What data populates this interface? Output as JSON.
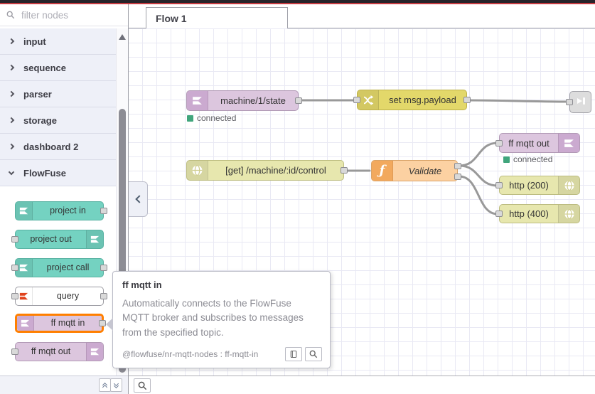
{
  "app": {
    "name": "Node-RED flow editor"
  },
  "palette": {
    "search": {
      "placeholder": "filter nodes"
    },
    "categories": [
      {
        "label": "input",
        "expanded": false
      },
      {
        "label": "sequence",
        "expanded": false
      },
      {
        "label": "parser",
        "expanded": false
      },
      {
        "label": "storage",
        "expanded": false
      },
      {
        "label": "dashboard 2",
        "expanded": false
      },
      {
        "label": "FlowFuse",
        "expanded": true
      }
    ],
    "nodes": [
      {
        "label": "project in",
        "color": "teal"
      },
      {
        "label": "project out",
        "color": "teal"
      },
      {
        "label": "project call",
        "color": "teal"
      },
      {
        "label": "query",
        "color": "white"
      },
      {
        "label": "ff mqtt in",
        "color": "purple",
        "highlighted": true
      },
      {
        "label": "ff mqtt out",
        "color": "purple"
      }
    ]
  },
  "tabs": [
    {
      "label": "Flow 1"
    }
  ],
  "canvas": {
    "nodes": [
      {
        "type": "ff mqtt in",
        "label": "machine/1/state",
        "status": "connected"
      },
      {
        "type": "change",
        "label": "set msg.payload"
      },
      {
        "type": "link out",
        "label": ""
      },
      {
        "type": "http in",
        "label": "[get] /machine/:id/control"
      },
      {
        "type": "function",
        "label": "Validate",
        "outputs": 2
      },
      {
        "type": "ff mqtt out",
        "label": "ff mqtt out",
        "status": "connected"
      },
      {
        "type": "http response",
        "label": "http (200)"
      },
      {
        "type": "http response",
        "label": "http (400)"
      }
    ],
    "wires": [
      {
        "from": "machine/1/state",
        "to": "set msg.payload"
      },
      {
        "from": "set msg.payload",
        "to": "link out"
      },
      {
        "from": "[get] /machine/:id/control",
        "to": "Validate"
      },
      {
        "from": "Validate:1",
        "to": "ff mqtt out"
      },
      {
        "from": "Validate:1",
        "to": "http (200)"
      },
      {
        "from": "Validate:2",
        "to": "http (400)"
      }
    ]
  },
  "tooltip": {
    "title": "ff mqtt in",
    "body": "Automatically connects to the FlowFuse MQTT broker and subscribes to messages from the specified topic.",
    "meta": "@flowfuse/nr-mqtt-nodes : ff-mqtt-in"
  },
  "colors": {
    "header_red": "#c43a40",
    "node_teal": "#74d2c1",
    "node_purple": "#dcc6de",
    "node_change_yellow": "#e3d86a",
    "node_http_olive": "#e7e7ae",
    "node_function_orange": "#fcd1a2",
    "node_link_gray": "#dddddd",
    "hover_highlight": "#ff7f00",
    "status_green": "#40a57c",
    "wire": "#999999"
  }
}
